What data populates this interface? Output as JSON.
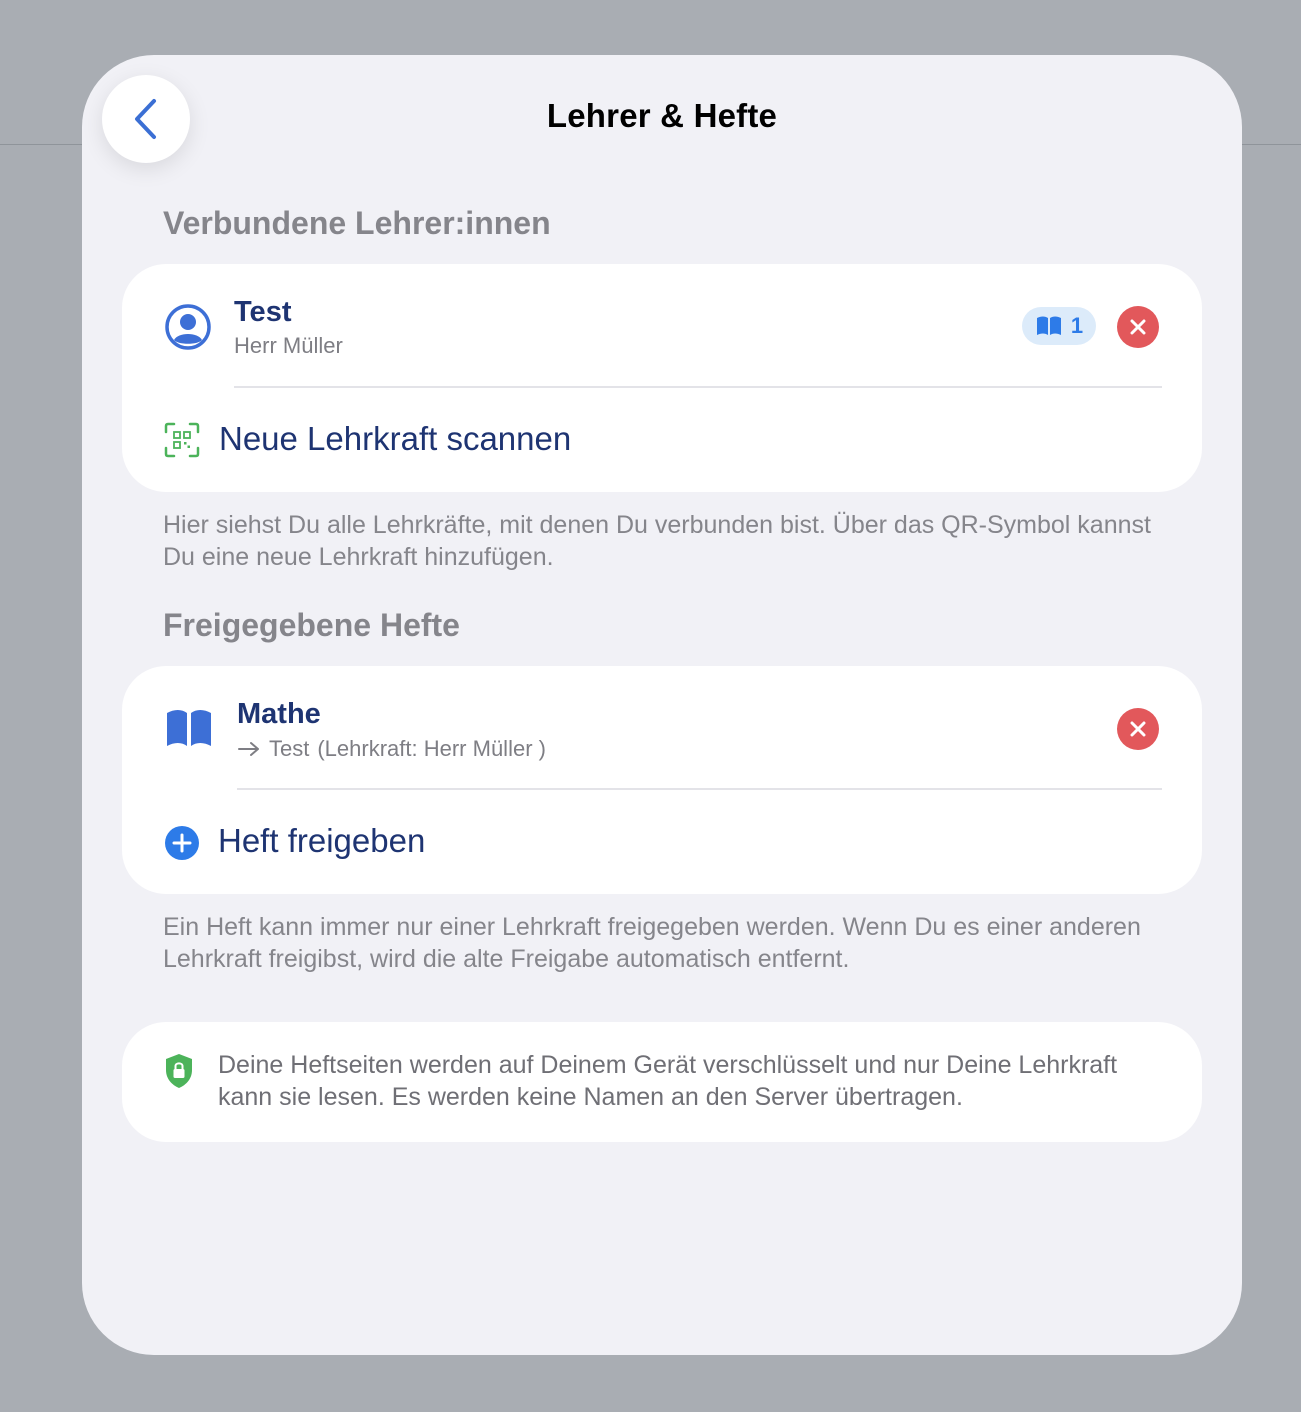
{
  "header": {
    "title": "Lehrer & Hefte",
    "back_icon": "chevron-left-icon"
  },
  "teachers_section": {
    "header": "Verbundene Lehrer:innen",
    "teacher": {
      "name": "Test",
      "subtitle": "Herr Müller",
      "icon": "person-circle-icon",
      "badge_count": "1",
      "badge_icon": "book-icon"
    },
    "scan_action": {
      "label": "Neue Lehrkraft scannen",
      "icon": "qr-scan-icon"
    },
    "footnote": "Hier siehst Du alle Lehrkräfte, mit denen Du verbunden bist. Über das QR-Symbol kannst Du eine neue Lehrkraft hinzufügen."
  },
  "notebooks_section": {
    "header": "Freigegebene Hefte",
    "notebook": {
      "name": "Mathe",
      "target": "Test",
      "teacher_note": "(Lehrkraft: Herr Müller )",
      "icon": "book-open-icon"
    },
    "share_action": {
      "label": "Heft freigeben",
      "icon": "plus-circle-icon"
    },
    "footnote": "Ein Heft kann immer nur einer Lehrkraft freigegeben werden. Wenn Du es einer anderen Lehrkraft freigibst, wird die alte Freigabe automatisch entfernt."
  },
  "privacy_info": {
    "text": "Deine Heftseiten werden auf Deinem Gerät verschlüsselt und nur Deine Lehrkraft kann sie lesen. Es werden keine Namen an den Server übertragen.",
    "icon": "lock-shield-icon"
  },
  "colors": {
    "accent_blue": "#2d7be8",
    "title_navy": "#1e3472",
    "remove_red": "#e2585b",
    "scan_green": "#4cb35a",
    "background": "#f1f1f6"
  }
}
